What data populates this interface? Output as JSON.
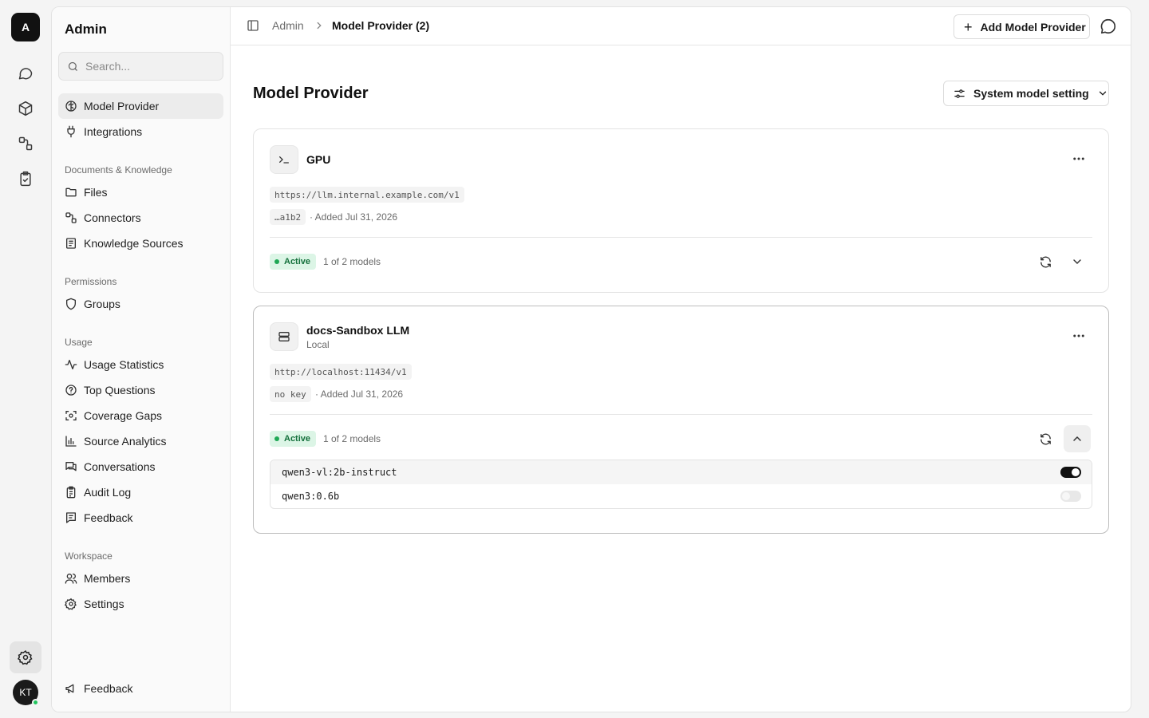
{
  "rail": {
    "logo": "A",
    "avatar": "KT"
  },
  "sidebar": {
    "title": "Admin",
    "search_placeholder": "Search...",
    "top_items": [
      {
        "label": "Model Provider",
        "icon": "brain-icon"
      },
      {
        "label": "Integrations",
        "icon": "plug-icon"
      }
    ],
    "sections": [
      {
        "title": "Documents & Knowledge",
        "items": [
          "Files",
          "Connectors",
          "Knowledge Sources"
        ]
      },
      {
        "title": "Permissions",
        "items": [
          "Groups"
        ]
      },
      {
        "title": "Usage",
        "items": [
          "Usage Statistics",
          "Top Questions",
          "Coverage Gaps",
          "Source Analytics",
          "Conversations",
          "Audit Log",
          "Feedback"
        ]
      },
      {
        "title": "Workspace",
        "items": [
          "Members",
          "Settings"
        ]
      }
    ],
    "footer_item": "Feedback"
  },
  "topbar": {
    "breadcrumb_root": "Admin",
    "breadcrumb_current": "Model Provider (2)",
    "add_button": "Add Model Provider"
  },
  "page": {
    "title": "Model Provider",
    "system_button": "System model setting"
  },
  "providers": [
    {
      "name": "GPU",
      "subtitle": "",
      "url": "https://llm.internal.example.com/v1",
      "key": "…a1b2",
      "added": "· Added Jul 31, 2026",
      "status": "Active",
      "models_count": "1 of 2 models",
      "expanded": false
    },
    {
      "name": "docs-Sandbox LLM",
      "subtitle": "Local",
      "url": "http://localhost:11434/v1",
      "key": "no key",
      "added": "· Added Jul 31, 2026",
      "status": "Active",
      "models_count": "1 of 2 models",
      "expanded": true,
      "models": [
        {
          "name": "qwen3-vl:2b-instruct",
          "enabled": true
        },
        {
          "name": "qwen3:0.6b",
          "enabled": false
        }
      ]
    }
  ],
  "colors": {
    "active_badge_bg": "#dcf5e6",
    "active_badge_text": "#13703b",
    "online_dot": "#22c55e"
  }
}
